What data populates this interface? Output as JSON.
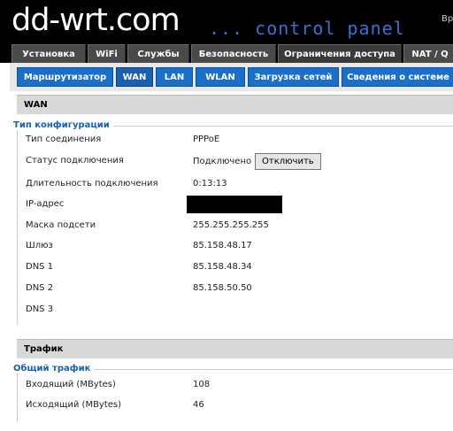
{
  "header": {
    "logo_text": "dd-wrt",
    "logo_domain": ".com",
    "panel_title": "... control panel",
    "corner": "Вр"
  },
  "main_tabs": [
    {
      "label": "Установка"
    },
    {
      "label": "WiFi"
    },
    {
      "label": "Службы"
    },
    {
      "label": "Безопасность"
    },
    {
      "label": "Ограничения доступа"
    },
    {
      "label": "NAT / Q"
    }
  ],
  "sub_tabs": [
    {
      "label": "Маршрутизатор"
    },
    {
      "label": "WAN"
    },
    {
      "label": "LAN"
    },
    {
      "label": "WLAN"
    },
    {
      "label": "Загрузка сетей"
    },
    {
      "label": "Сведения о системе"
    }
  ],
  "wan_section": {
    "title": "WAN",
    "fieldset_title": "Тип конфигурации",
    "rows": [
      {
        "label": "Тип соединения",
        "value": "PPPoE"
      },
      {
        "label": "Статус подключения",
        "value": "Подключено"
      },
      {
        "label": "Длительность подключения",
        "value": "0:13:13"
      },
      {
        "label": "IP-адрес",
        "value": ""
      },
      {
        "label": "Маска подсети",
        "value": "255.255.255.255"
      },
      {
        "label": "Шлюз",
        "value": "85.158.48.17"
      },
      {
        "label": "DNS 1",
        "value": "85.158.48.34"
      },
      {
        "label": "DNS 2",
        "value": "85.158.50.50"
      },
      {
        "label": "DNS 3",
        "value": ""
      }
    ],
    "disconnect_button": "Отключить"
  },
  "traffic_section": {
    "title": "Трафик",
    "fieldset_title": "Общий трафик",
    "rows": [
      {
        "label": "Входящий (MBytes)",
        "value": "108"
      },
      {
        "label": "Исходящий (MBytes)",
        "value": "46"
      }
    ]
  }
}
